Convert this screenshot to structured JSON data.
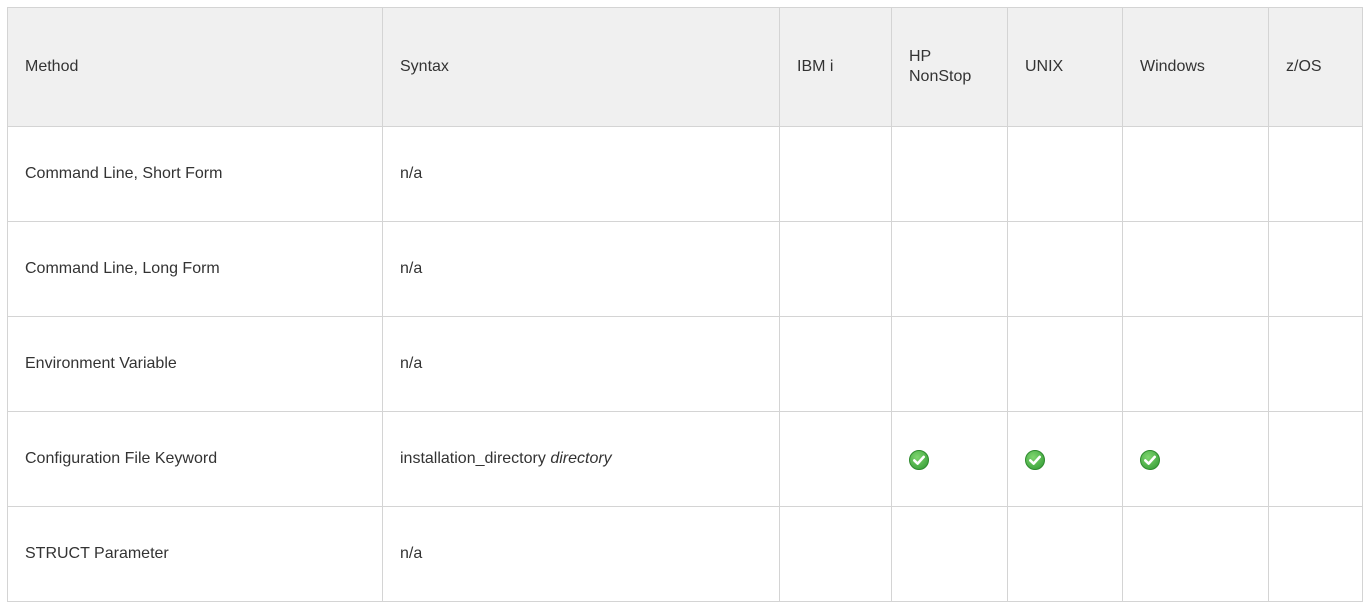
{
  "table": {
    "headers": [
      "Method",
      "Syntax",
      "IBM i",
      "HP NonStop",
      "UNIX",
      "Windows",
      "z/OS"
    ],
    "header_hp_lines": [
      "HP",
      "NonStop"
    ],
    "rows": [
      {
        "method": "Command Line, Short Form",
        "syntax": "n/a",
        "syntax_param": "",
        "support": {
          "ibmi": false,
          "hpnonstop": false,
          "unix": false,
          "windows": false,
          "zos": false
        }
      },
      {
        "method": "Command Line, Long Form",
        "syntax": "n/a",
        "syntax_param": "",
        "support": {
          "ibmi": false,
          "hpnonstop": false,
          "unix": false,
          "windows": false,
          "zos": false
        }
      },
      {
        "method": "Environment Variable",
        "syntax": "n/a",
        "syntax_param": "",
        "support": {
          "ibmi": false,
          "hpnonstop": false,
          "unix": false,
          "windows": false,
          "zos": false
        }
      },
      {
        "method": "Configuration File Keyword",
        "syntax": "installation_directory",
        "syntax_param": "directory",
        "support": {
          "ibmi": false,
          "hpnonstop": true,
          "unix": true,
          "windows": true,
          "zos": false
        }
      },
      {
        "method": "STRUCT Parameter",
        "syntax": "n/a",
        "syntax_param": "",
        "support": {
          "ibmi": false,
          "hpnonstop": false,
          "unix": false,
          "windows": false,
          "zos": false
        }
      }
    ]
  },
  "icons": {
    "supported": "check-circle-icon"
  },
  "colors": {
    "header_bg": "#f0f0f0",
    "border": "#d4d4d4",
    "check_fill": "#3ca23c"
  }
}
